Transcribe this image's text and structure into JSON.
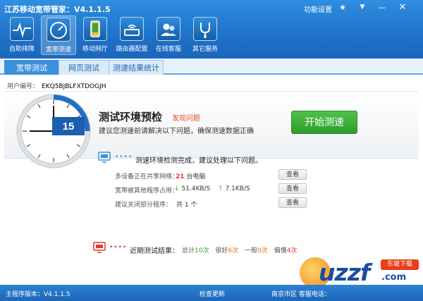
{
  "window": {
    "title": "江苏移动宽带管家：V4.1.1.5",
    "func_settings": "功能设置"
  },
  "nav": [
    {
      "label": "自助排障"
    },
    {
      "label": "宽带测速"
    },
    {
      "label": "移动网厅"
    },
    {
      "label": "路由器配置"
    },
    {
      "label": "在线客服"
    },
    {
      "label": "其它服务"
    }
  ],
  "tabs": [
    {
      "label": "宽带测试"
    },
    {
      "label": "网页测试"
    },
    {
      "label": "测速结果统计"
    }
  ],
  "user": {
    "label": "用户编号：",
    "id": "EKQ5BJBLFXTDOGJH"
  },
  "gauge": {
    "value": "15"
  },
  "precheck": {
    "title": "测试环境预检",
    "link": "发现问题",
    "tip": "建议您测速前请解决以下问题，确保测速数据正确",
    "start_button": "开始测速"
  },
  "env": {
    "dots": "••••",
    "text": "测速环境检测完成，建议处理以下问题。",
    "items": [
      {
        "label": "多设备正在共享网络：",
        "count": "21",
        "unit": "台电脑",
        "button": "查看"
      },
      {
        "label": "宽带被其他程序占用：",
        "down": "51.4KB/S",
        "up": "7.1KB/S",
        "button": "查看"
      },
      {
        "label": "建议关闭部分程序：",
        "prefix": "共",
        "count": "1",
        "unit": "个",
        "button": "查看"
      }
    ]
  },
  "recent": {
    "dots": "••••",
    "title": "近期测试结果：",
    "total_label": "总计",
    "total": "10次",
    "good_label": "很好",
    "good": "6次",
    "normal_label": "一般",
    "normal": "0次",
    "low_label": "偏慢",
    "low": "4次"
  },
  "status": {
    "version": "主程序版本：V4.1.1.5",
    "check_update": "检查更新",
    "region": "南京市区    客服电话："
  },
  "watermark": {
    "text": "uzzf",
    "badge": "东坡下载",
    "domain": ".com"
  },
  "colors": {
    "header": "#1f74cb",
    "accent": "#3d8fdc",
    "start": "#36a832",
    "warn": "#e5531a"
  }
}
